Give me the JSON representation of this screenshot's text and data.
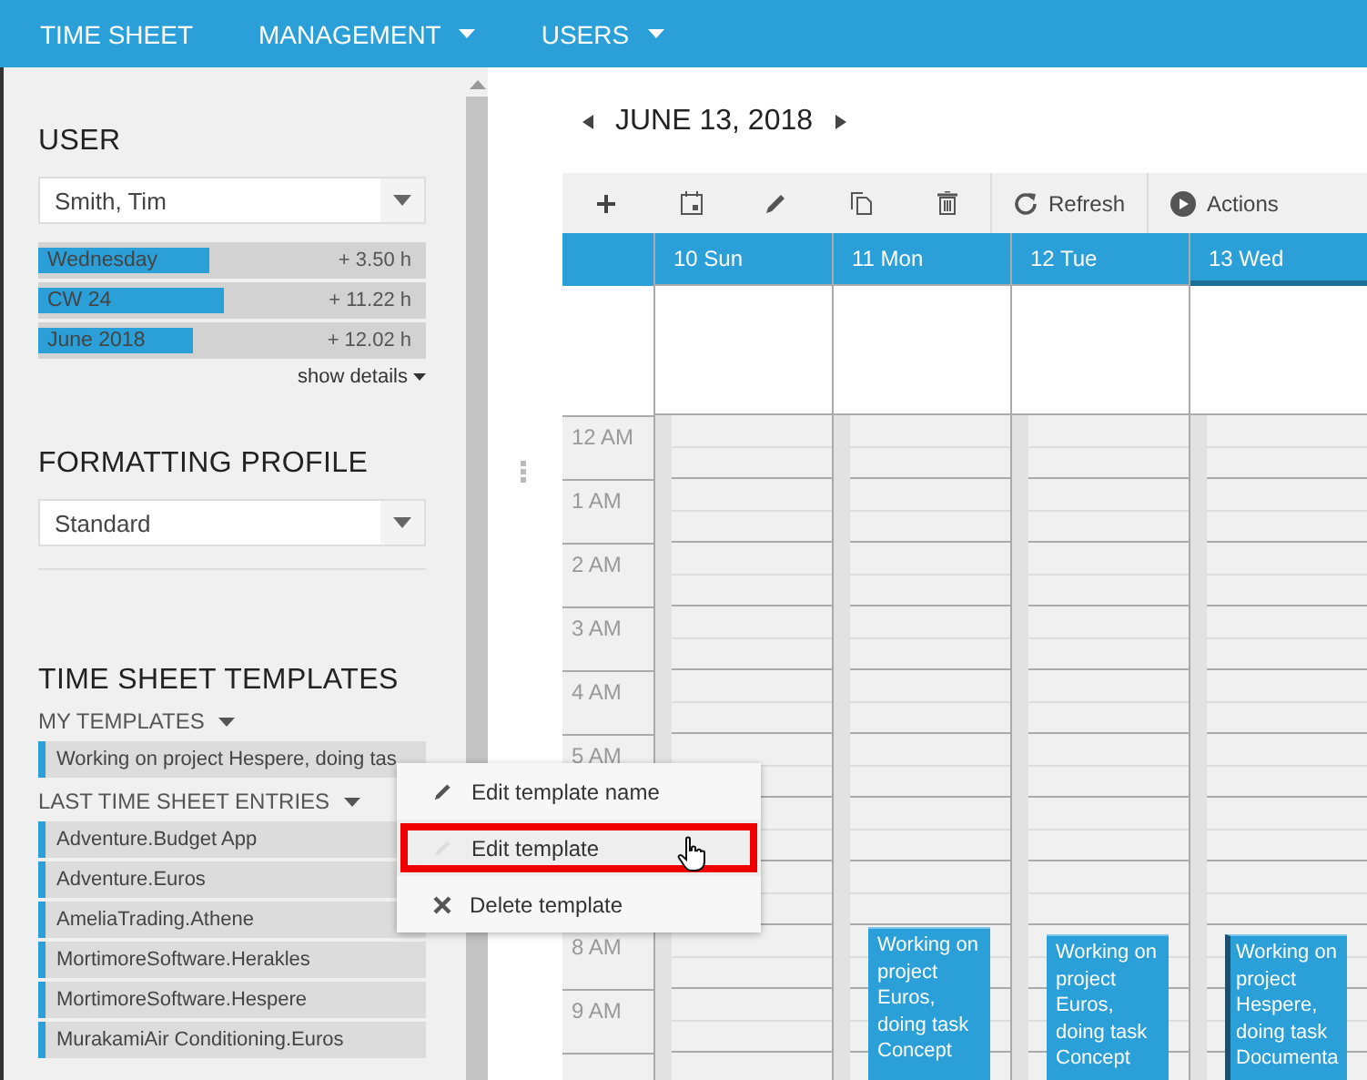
{
  "nav": [
    {
      "label": "TIME SHEET",
      "dropdown": false
    },
    {
      "label": "MANAGEMENT",
      "dropdown": true
    },
    {
      "label": "USERS",
      "dropdown": true
    }
  ],
  "sidebar": {
    "user": {
      "title": "USER",
      "select": "Smith, Tim",
      "stats": [
        {
          "label": "Wednesday",
          "value": "+ 3.50 h",
          "level": 0.44
        },
        {
          "label": "CW 24",
          "value": "+ 11.22 h",
          "level": 0.48
        },
        {
          "label": "June 2018",
          "value": "+ 12.02 h",
          "level": 0.4
        }
      ],
      "details_link": "show details"
    },
    "formatting": {
      "title": "FORMATTING PROFILE",
      "select": "Standard"
    },
    "templates": {
      "title": "TIME SHEET TEMPLATES",
      "my_templates": {
        "label": "MY TEMPLATES",
        "items": [
          "Working on project Hespere, doing tas"
        ]
      },
      "last_entries": {
        "label": "LAST TIME SHEET ENTRIES",
        "items": [
          "Adventure.Budget App",
          "Adventure.Euros",
          "AmeliaTrading.Athene",
          "MortimoreSoftware.Herakles",
          "MortimoreSoftware.Hespere",
          "MurakamiAir Conditioning.Euros"
        ]
      }
    }
  },
  "calendar": {
    "date": "JUNE 13, 2018",
    "toolbar": [
      {
        "kind": "add"
      },
      {
        "kind": "calendar"
      },
      {
        "kind": "edit"
      },
      {
        "kind": "copy"
      },
      {
        "kind": "delete"
      },
      {
        "kind": "refresh",
        "label": "Refresh"
      },
      {
        "kind": "actions",
        "label": "Actions"
      }
    ],
    "days": [
      {
        "label": "10 Sun",
        "selected": false
      },
      {
        "label": "11 Mon",
        "selected": false,
        "events": [
          {
            "text": "Working on project Euros, doing task Concept",
            "selected": false
          }
        ]
      },
      {
        "label": "12 Tue",
        "selected": false,
        "events": [
          {
            "text": "Working on project Euros, doing task Concept",
            "selected": false
          }
        ]
      },
      {
        "label": "13 Wed",
        "selected": true,
        "events": [
          {
            "text": "Working on project Hespere, doing task Documenta",
            "selected": true
          }
        ]
      }
    ],
    "hours_top": [
      "12 AM",
      "1 AM",
      "2 AM",
      "3 AM",
      "4 AM",
      "5 AM"
    ],
    "hours_bottom": [
      "8 AM",
      "9 AM"
    ]
  },
  "context_menu": [
    {
      "kind": "edit",
      "label": "Edit template name",
      "highlighted": false,
      "disabled": false
    },
    {
      "kind": "edit",
      "label": "Edit template",
      "highlighted": true,
      "disabled": true
    },
    {
      "kind": "delete",
      "label": "Delete template",
      "highlighted": false,
      "disabled": false
    }
  ]
}
